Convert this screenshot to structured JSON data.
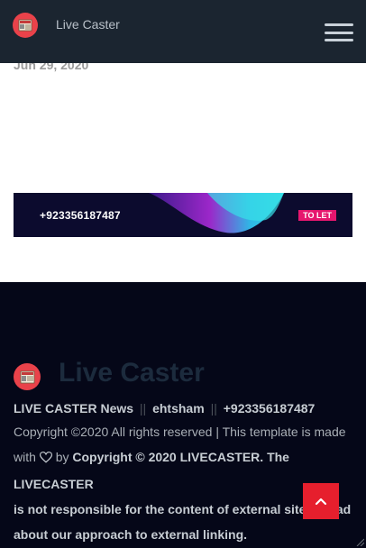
{
  "header": {
    "brand": "Live Caster",
    "logo_icon": "newspaper-icon",
    "menu_icon": "hamburger-menu-icon"
  },
  "post": {
    "date": "Jun 29, 2020"
  },
  "ad": {
    "phone": "+923356187487",
    "badge": "TO LET"
  },
  "footer": {
    "brand": "Live Caster",
    "credit_site": "LIVE CASTER News",
    "credit_author": "ehtsham",
    "credit_phone": "+923356187487",
    "separator": "||",
    "copyright_line": "Copyright ©2020 All rights reserved | This template is made",
    "with_text": "with",
    "by_text": "by",
    "copyright_bold": "Copyright © 2020 LIVECASTER. The LIVECASTER",
    "disclaimer": "is not responsible for the content of external sites. Read about our approach to external linking."
  },
  "back_to_top_icon": "chevron-up-icon",
  "colors": {
    "header_bg": "#1b2530",
    "footer_bg": "#050718",
    "accent_red": "#e61f2d",
    "ad_badge": "#e6166e"
  }
}
